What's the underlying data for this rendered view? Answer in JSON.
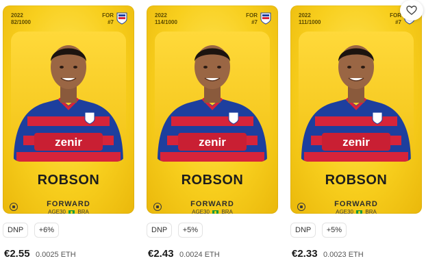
{
  "cards": [
    {
      "season": "2022",
      "serial": "82/1000",
      "club_code": "FOR",
      "jersey": "#7",
      "name": "ROBSON",
      "position": "FORWARD",
      "age_label": "AGE",
      "age": "30",
      "nation": "BRA",
      "badge_status": "DNP",
      "badge_bonus": "+6%",
      "price_eur": "€2.55",
      "price_eth": "0.0025 ETH"
    },
    {
      "season": "2022",
      "serial": "114/1000",
      "club_code": "FOR",
      "jersey": "#7",
      "name": "ROBSON",
      "position": "FORWARD",
      "age_label": "AGE",
      "age": "30",
      "nation": "BRA",
      "badge_status": "DNP",
      "badge_bonus": "+5%",
      "price_eur": "€2.43",
      "price_eth": "0.0024 ETH"
    },
    {
      "season": "2022",
      "serial": "111/1000",
      "club_code": "FOR",
      "jersey": "#7",
      "name": "ROBSON",
      "position": "FORWARD",
      "age_label": "AGE",
      "age": "30",
      "nation": "BRA",
      "badge_status": "DNP",
      "badge_bonus": "+5%",
      "price_eur": "€2.33",
      "price_eth": "0.0023 ETH"
    }
  ],
  "jersey_sponsor": "zenir",
  "icons": {
    "favorite": "heart-icon",
    "scarcity": "ball-icon",
    "crest": "club-crest-icon"
  },
  "colors": {
    "card_gold": "#f8cf1e",
    "jersey_blue": "#1d3f9e",
    "jersey_red": "#d6243a"
  }
}
